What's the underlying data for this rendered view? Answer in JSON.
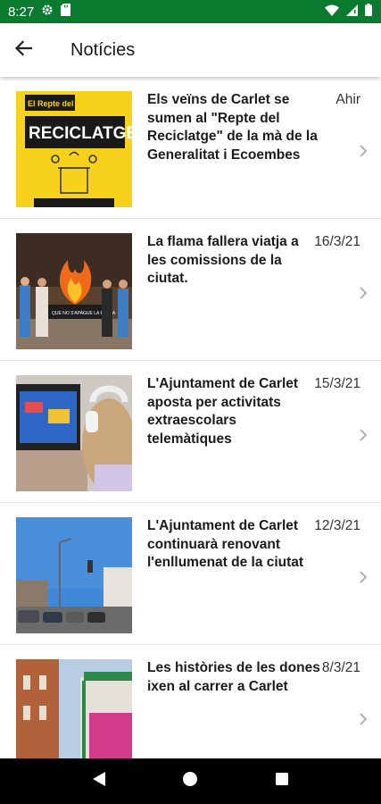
{
  "status_bar": {
    "time": "8:27",
    "left_icons": [
      "gear-icon",
      "sd-card-icon"
    ],
    "right_icons": [
      "wifi-icon",
      "signal-icon",
      "battery-icon"
    ],
    "background": "#0a7a2f"
  },
  "app_bar": {
    "title": "Notícies",
    "back_icon": "back-arrow-icon"
  },
  "news": [
    {
      "title": "Els veïns de Carlet se sumen al \"Repte del Reciclatge\" de la mà de la Generalitat i Ecoembes",
      "date": "Ahir",
      "thumb_text_top": "El Repte del",
      "thumb_text_main": "RECICLATGE"
    },
    {
      "title": "La flama fallera viatja a les comissions de la ciutat.",
      "date": "16/3/21",
      "thumb_text_main": "QUE NO S'APAGUE LA FLAMA"
    },
    {
      "title": "L'Ajuntament de Carlet aposta per activitats extraescolars telemàtiques",
      "date": "15/3/21"
    },
    {
      "title": "L'Ajuntament de Carlet continuarà renovant l'enllumenat de la ciutat",
      "date": "12/3/21"
    },
    {
      "title": "Les històries de les dones ixen al carrer a Carlet",
      "date": "8/3/21"
    }
  ],
  "nav_bar": {
    "buttons": [
      "back-triangle-icon",
      "home-circle-icon",
      "recents-square-icon"
    ]
  },
  "colors": {
    "accent": "#0a7a2f",
    "divider": "#e2e2e2",
    "chevron": "#b0b0b0"
  }
}
